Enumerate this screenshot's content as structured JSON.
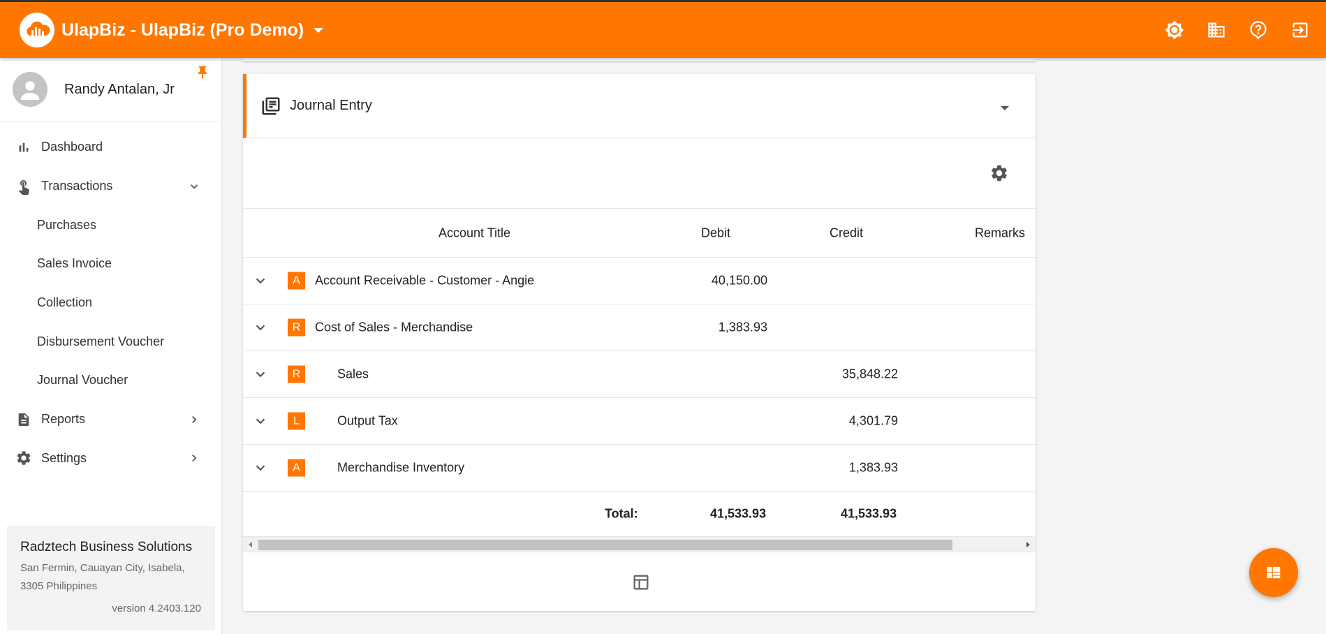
{
  "app": {
    "brand_text": "UlapBiz -  UlapBiz (Pro Demo)"
  },
  "header_icons": [
    "brightness-icon",
    "business-icon",
    "help-icon",
    "logout-icon"
  ],
  "colors": {
    "accent": "#ff7600",
    "sidebar_bg": "#ffffff",
    "page_bg": "#f4f4f4"
  },
  "user": {
    "name": "Randy Antalan, Jr"
  },
  "sidebar": {
    "items": [
      {
        "label": "Dashboard"
      },
      {
        "label": "Transactions"
      },
      {
        "label": "Reports"
      },
      {
        "label": "Settings"
      }
    ],
    "transactions_sub": [
      {
        "label": "Purchases"
      },
      {
        "label": "Sales Invoice"
      },
      {
        "label": "Collection"
      },
      {
        "label": "Disbursement Voucher"
      },
      {
        "label": "Journal Voucher"
      }
    ]
  },
  "company": {
    "name": "Radztech Business Solutions",
    "address_line1": "San Fermin, Cauayan City, Isabela,",
    "address_line2": "3305 Philippines",
    "version": "version 4.2403.120"
  },
  "journal": {
    "title": "Journal Entry",
    "columns": {
      "account": "Account Title",
      "debit": "Debit",
      "credit": "Credit",
      "remarks": "Remarks"
    },
    "rows": [
      {
        "badge": "A",
        "account": "Account Receivable - Customer - Angie",
        "debit": "40,150.00",
        "credit": ""
      },
      {
        "badge": "R",
        "account": "Cost of Sales - Merchandise",
        "debit": "1,383.93",
        "credit": ""
      },
      {
        "badge": "R",
        "account": "Sales",
        "debit": "",
        "credit": "35,848.22"
      },
      {
        "badge": "L",
        "account": "Output Tax",
        "debit": "",
        "credit": "4,301.79"
      },
      {
        "badge": "A",
        "account": "Merchandise Inventory",
        "debit": "",
        "credit": "1,383.93"
      }
    ],
    "total_label": "Total:",
    "total_debit": "41,533.93",
    "total_credit": "41,533.93"
  }
}
